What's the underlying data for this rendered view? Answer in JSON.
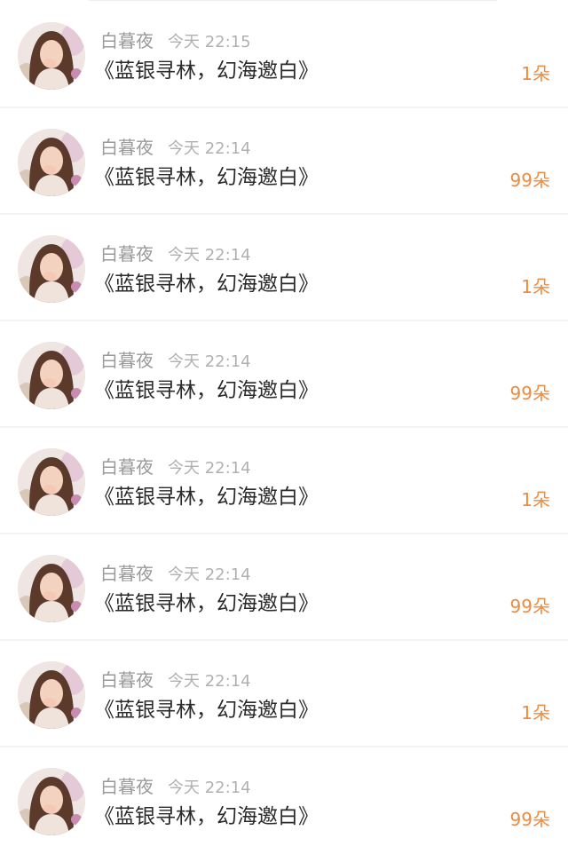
{
  "icons": {
    "avatar": "user-avatar-photo"
  },
  "colors": {
    "name_text": "#9a9a9a",
    "time_text": "#b0b0b0",
    "message_text": "#2a2a2a",
    "gift_count_text": "#f08a3c",
    "separator": "#f3f3f3"
  },
  "items": [
    {
      "user": "白暮夜",
      "time": "今天 22:15",
      "message": "《蓝银寻林，幻海邀白》",
      "gift": "1朵"
    },
    {
      "user": "白暮夜",
      "time": "今天 22:14",
      "message": "《蓝银寻林，幻海邀白》",
      "gift": "99朵"
    },
    {
      "user": "白暮夜",
      "time": "今天 22:14",
      "message": "《蓝银寻林，幻海邀白》",
      "gift": "1朵"
    },
    {
      "user": "白暮夜",
      "time": "今天 22:14",
      "message": "《蓝银寻林，幻海邀白》",
      "gift": "99朵"
    },
    {
      "user": "白暮夜",
      "time": "今天 22:14",
      "message": "《蓝银寻林，幻海邀白》",
      "gift": "1朵"
    },
    {
      "user": "白暮夜",
      "time": "今天 22:14",
      "message": "《蓝银寻林，幻海邀白》",
      "gift": "99朵"
    },
    {
      "user": "白暮夜",
      "time": "今天 22:14",
      "message": "《蓝银寻林，幻海邀白》",
      "gift": "1朵"
    },
    {
      "user": "白暮夜",
      "time": "今天 22:14",
      "message": "《蓝银寻林，幻海邀白》",
      "gift": "99朵"
    }
  ]
}
